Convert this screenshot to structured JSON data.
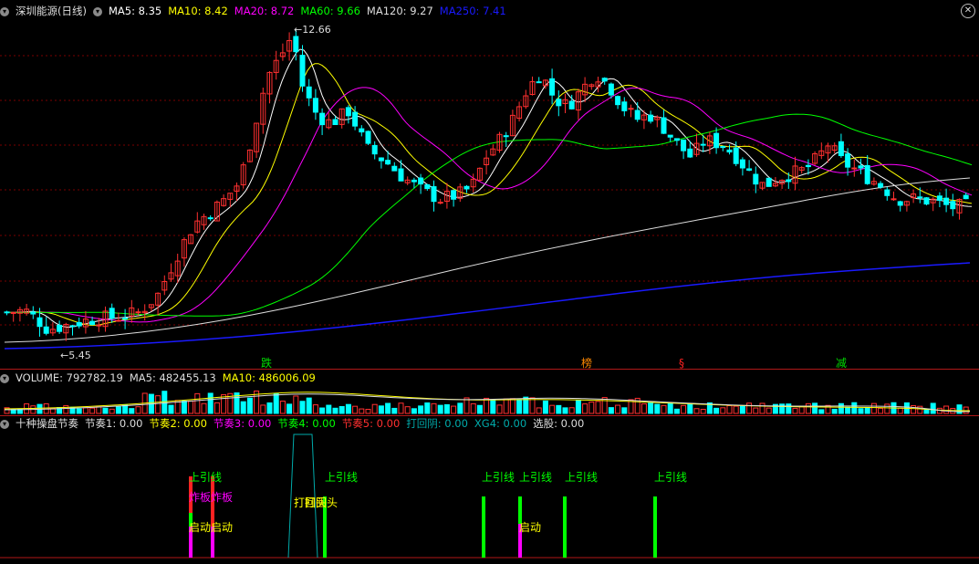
{
  "main": {
    "title": "深圳能源(日线)",
    "ma": [
      {
        "label": "MA5: 8.35",
        "color": "#ffffff"
      },
      {
        "label": "MA10: 8.42",
        "color": "#ffff00"
      },
      {
        "label": "MA20: 8.72",
        "color": "#ff00ff"
      },
      {
        "label": "MA60: 9.66",
        "color": "#00ff00"
      },
      {
        "label": "MA120: 9.27",
        "color": "#dddddd"
      },
      {
        "label": "MA250: 7.41",
        "color": "#1a1aff"
      }
    ],
    "high_label": "12.66",
    "low_label": "5.45",
    "signals": [
      {
        "text": "跌",
        "color": "#00dd00"
      },
      {
        "text": "榜",
        "color": "#ff8800"
      },
      {
        "text": "§",
        "color": "#ff2222"
      },
      {
        "text": "减",
        "color": "#00dd00"
      }
    ]
  },
  "volume": {
    "items": [
      {
        "label": "VOLUME: 792782.19",
        "color": "#dddddd"
      },
      {
        "label": "MA5: 482455.13",
        "color": "#dddddd"
      },
      {
        "label": "MA10: 486006.09",
        "color": "#ffff00"
      }
    ]
  },
  "indicator": {
    "items": [
      {
        "label": "十种操盘节奏",
        "color": "#dddddd"
      },
      {
        "label": "节奏1: 0.00",
        "color": "#dddddd"
      },
      {
        "label": "节奏2: 0.00",
        "color": "#ffff00"
      },
      {
        "label": "节奏3: 0.00",
        "color": "#ff00ff"
      },
      {
        "label": "节奏4: 0.00",
        "color": "#00ff00"
      },
      {
        "label": "节奏5: 0.00",
        "color": "#ff3030"
      },
      {
        "label": "打回阴: 0.00",
        "color": "#00aaaa"
      },
      {
        "label": "XG4: 0.00",
        "color": "#00aaaa"
      },
      {
        "label": "选股: 0.00",
        "color": "#dddddd"
      }
    ],
    "labels": {
      "up": "上引线",
      "zhaban": "炸板",
      "qidong": "启动",
      "dahuitou": "打回头"
    }
  },
  "colors": {
    "up": "#ff3030",
    "down": "#00ffff",
    "grid": "#7a0000"
  }
}
